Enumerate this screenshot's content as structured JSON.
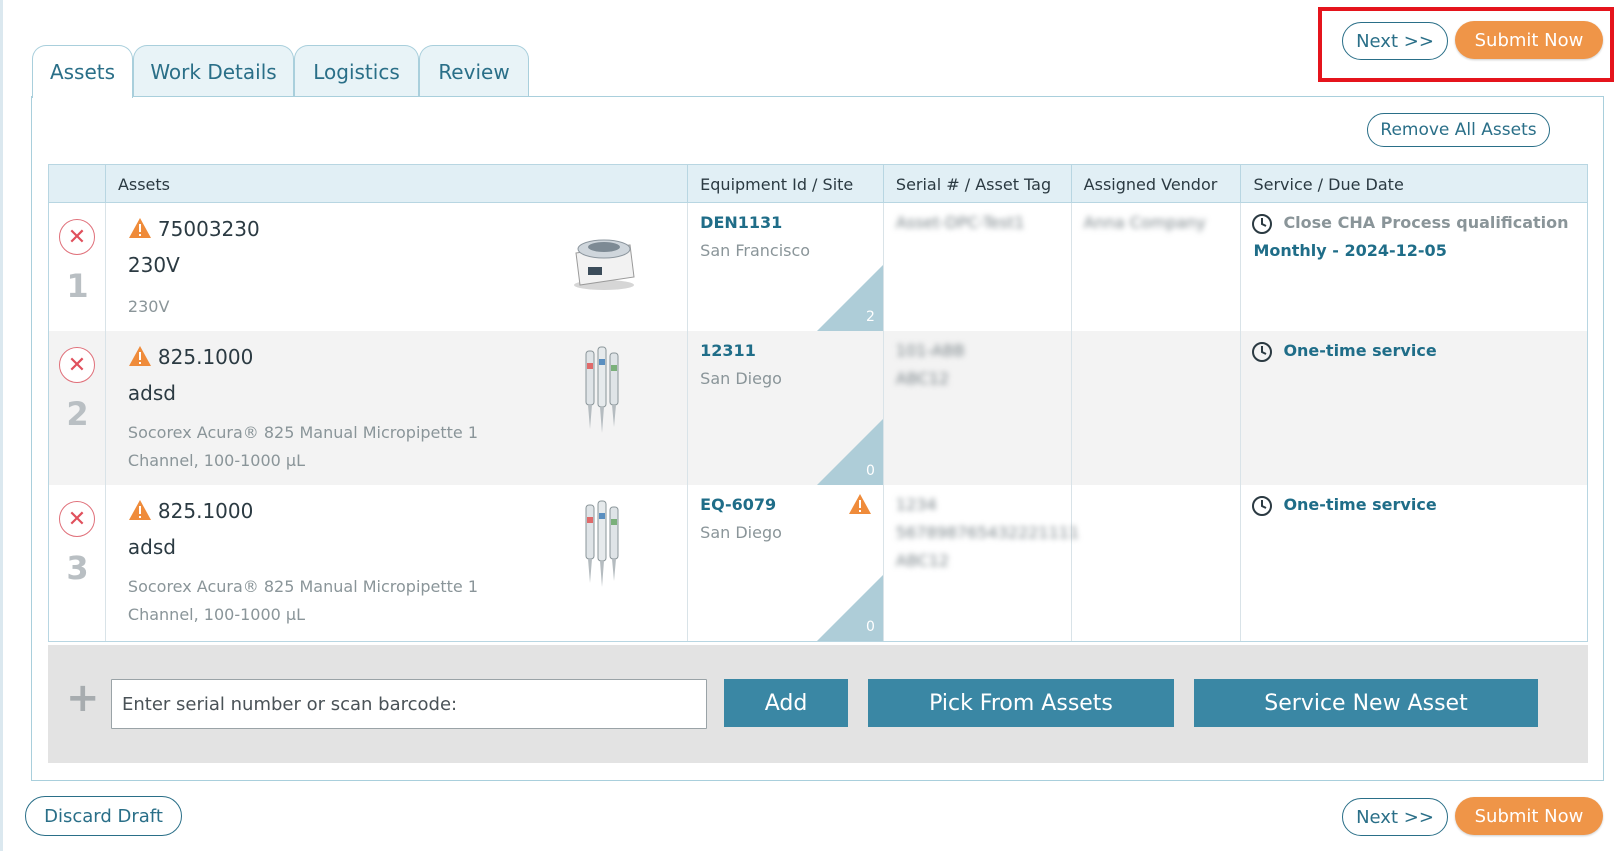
{
  "top_actions": {
    "next_label": "Next >>",
    "submit_label": "Submit Now"
  },
  "tabs": [
    {
      "label": "Assets",
      "active": true
    },
    {
      "label": "Work Details",
      "active": false
    },
    {
      "label": "Logistics",
      "active": false
    },
    {
      "label": "Review",
      "active": false
    }
  ],
  "remove_all_label": "Remove All Assets",
  "table": {
    "columns": [
      "",
      "Assets",
      "Equipment Id / Site",
      "Serial # / Asset Tag",
      "Assigned Vendor",
      "Service / Due Date"
    ],
    "rows": [
      {
        "number": "1",
        "asset_id": "75003230",
        "asset_line2": "230V",
        "asset_line3": "230V",
        "equipment_id": "DEN1131",
        "site": "San Francisco",
        "count": "2",
        "serial_lines": [
          "Asset-DPC-Test1"
        ],
        "vendor": "Anna Company",
        "service_name": "Close CHA Process qualification",
        "service_sub": "Monthly - 2024-12-05",
        "service_color": "#8a9599"
      },
      {
        "number": "2",
        "asset_id": "825.1000",
        "asset_line2": "adsd",
        "asset_line3": "Socorex Acura® 825 Manual Micropipette 1 Channel, 100-1000 µL",
        "equipment_id": "12311",
        "site": "San Diego",
        "count": "0",
        "serial_lines": [
          "101-ABB",
          "ABC12"
        ],
        "vendor": "",
        "service_name": "One-time service",
        "service_sub": "",
        "service_color": "#1f6d88"
      },
      {
        "number": "3",
        "asset_id": "825.1000",
        "asset_line2": "adsd",
        "asset_line3": "Socorex Acura® 825 Manual Micropipette 1 Channel, 100-1000 µL",
        "equipment_id": "EQ-6079",
        "site": "San Diego",
        "count": "0",
        "serial_lines": [
          "1234",
          "567898765432221111",
          "ABC12"
        ],
        "vendor": "",
        "service_name": "One-time service",
        "service_sub": "",
        "service_color": "#1f6d88"
      }
    ]
  },
  "add_bar": {
    "input_placeholder": "Enter serial number or scan barcode:",
    "add_label": "Add",
    "pick_label": "Pick From Assets",
    "service_new_label": "Service New Asset"
  },
  "bottom": {
    "discard_label": "Discard Draft",
    "next_label": "Next >>",
    "submit_label": "Submit Now"
  },
  "colors": {
    "accent": "#2a6f88",
    "submit": "#ef9548",
    "bar_button": "#3a87a4",
    "highlight": "#e5141c",
    "warning": "#ef8b3a"
  }
}
